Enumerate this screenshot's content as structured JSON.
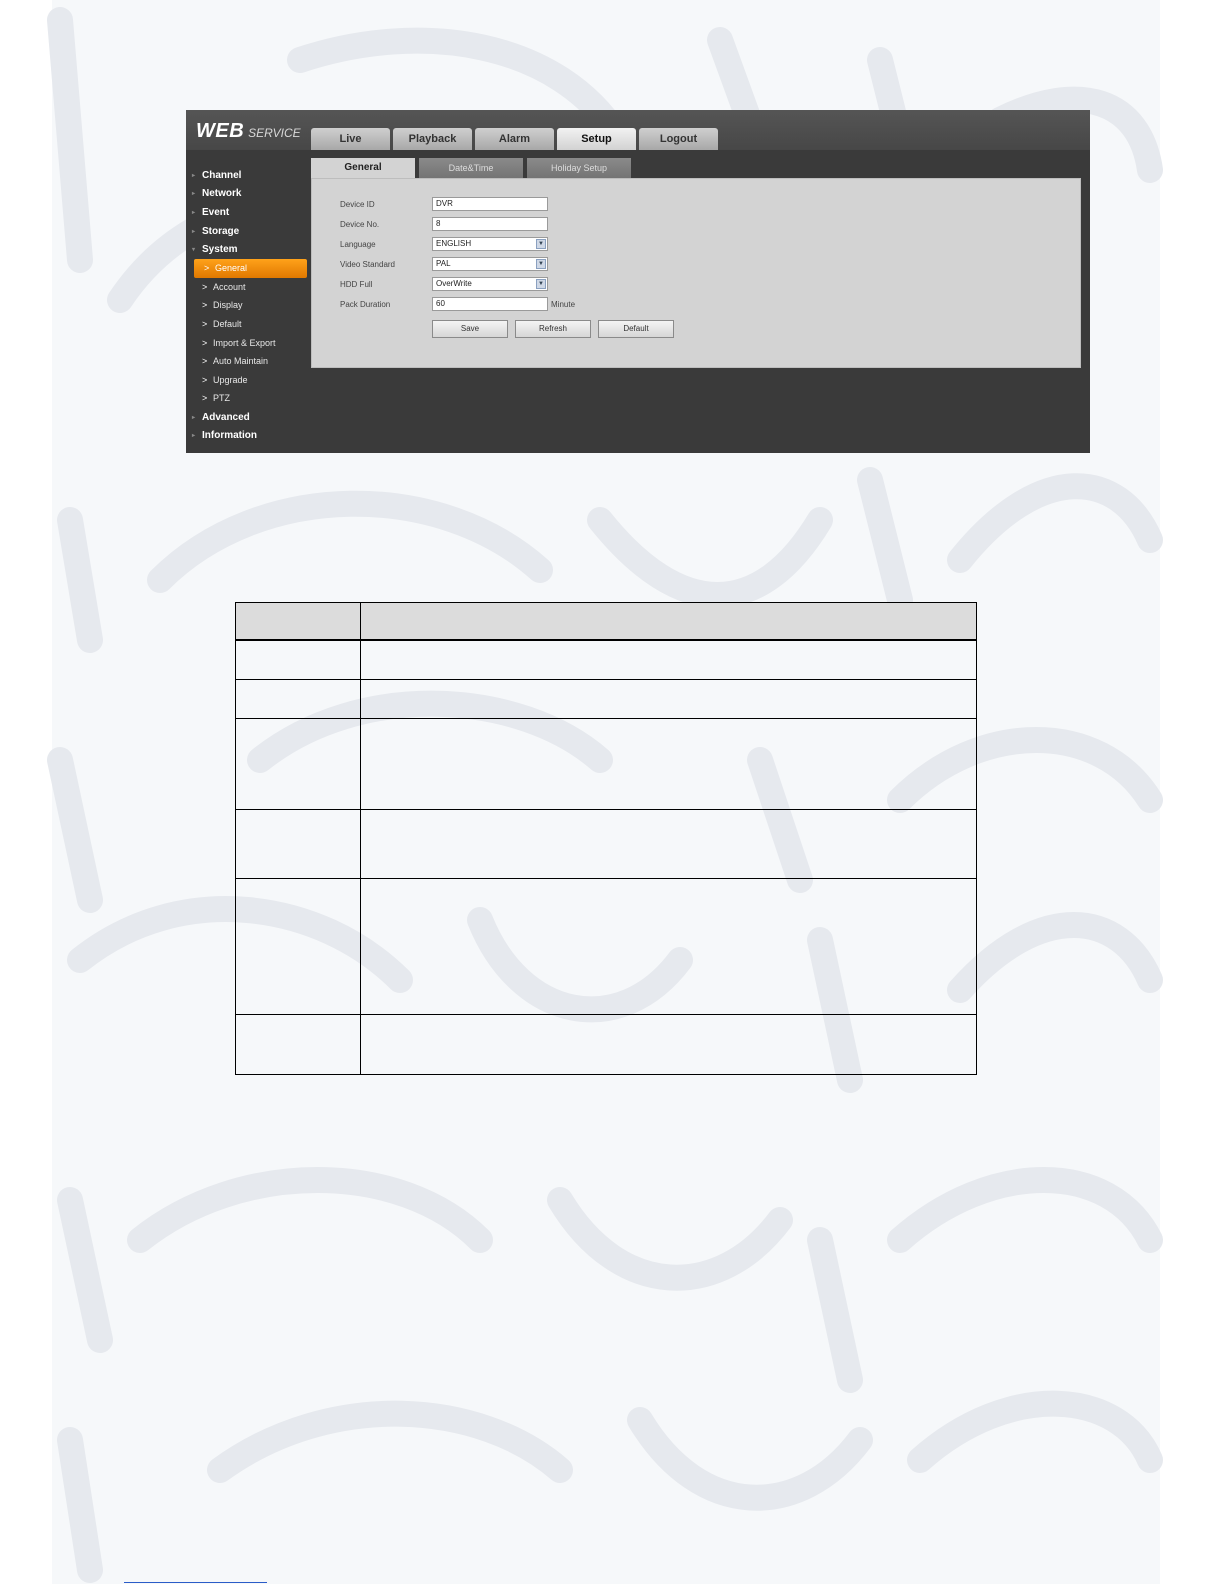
{
  "webui": {
    "logo": {
      "web": "WEB",
      "service": "SERVICE"
    },
    "main_tabs": [
      "Live",
      "Playback",
      "Alarm",
      "Setup",
      "Logout"
    ],
    "active_main_tab": "Setup",
    "sidebar": {
      "groups_top": [
        "Channel",
        "Network",
        "Event",
        "Storage",
        "System"
      ],
      "system_items": [
        "General",
        "Account",
        "Display",
        "Default",
        "Import & Export",
        "Auto Maintain",
        "Upgrade",
        "PTZ"
      ],
      "active_item": "General",
      "groups_bottom": [
        "Advanced",
        "Information"
      ]
    },
    "sub_tabs": [
      "General",
      "Date&Time",
      "Holiday Setup"
    ],
    "active_sub_tab": "General",
    "form": {
      "device_id": {
        "label": "Device ID",
        "value": "DVR"
      },
      "device_no": {
        "label": "Device No.",
        "value": "8"
      },
      "language": {
        "label": "Language",
        "value": "ENGLISH"
      },
      "video_standard": {
        "label": "Video Standard",
        "value": "PAL"
      },
      "hdd_full": {
        "label": "HDD Full",
        "value": "OverWrite"
      },
      "pack_duration": {
        "label": "Pack Duration",
        "value": "60",
        "unit": "Minute"
      }
    },
    "buttons": {
      "save": "Save",
      "refresh": "Refresh",
      "default": "Default"
    }
  },
  "table": {
    "header": [
      "",
      ""
    ],
    "rows": [
      [
        "",
        ""
      ],
      [
        "",
        ""
      ],
      [
        "",
        ""
      ],
      [
        "",
        ""
      ],
      [
        "",
        ""
      ],
      [
        "",
        ""
      ]
    ]
  }
}
